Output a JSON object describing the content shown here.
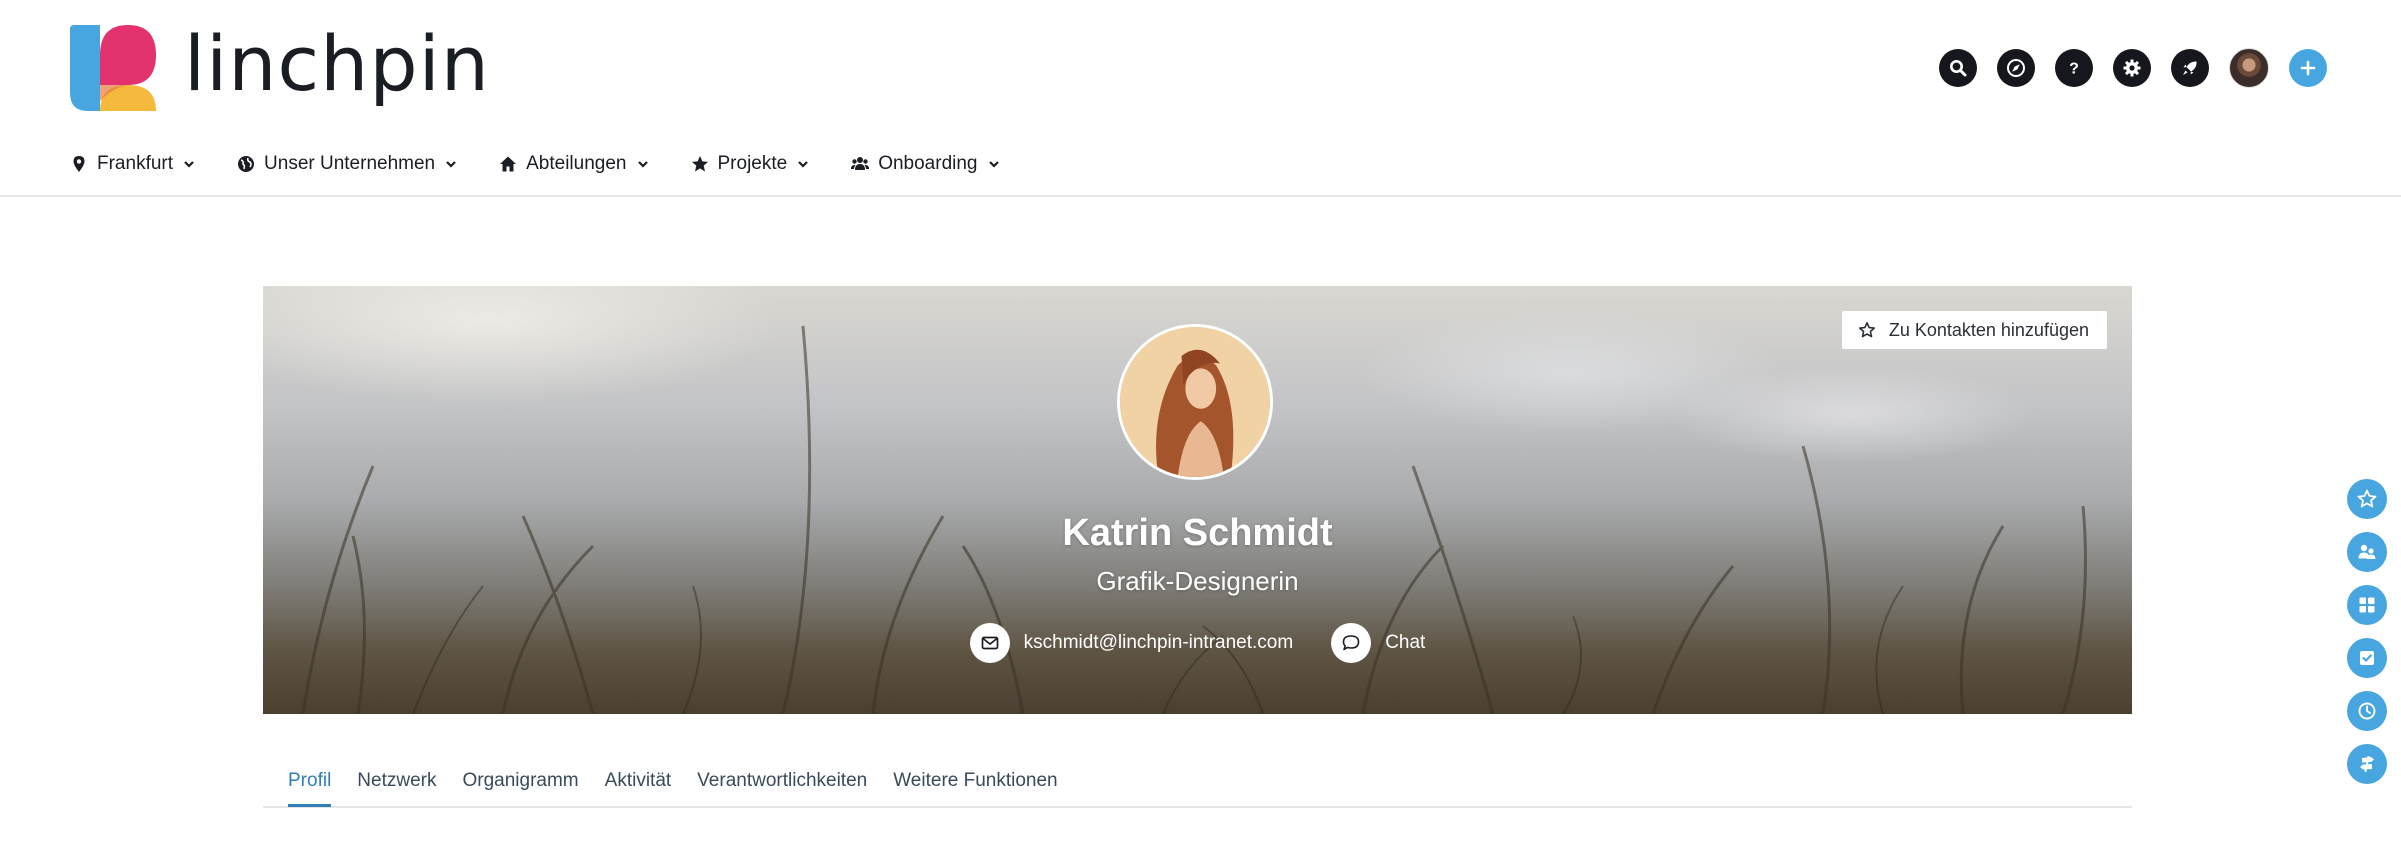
{
  "app": {
    "logo_text": "linchpin",
    "brand_colors": {
      "blue": "#47a6df",
      "pink": "#e2336e",
      "yellow": "#f5b93d",
      "dark": "#15171c"
    }
  },
  "header_icons": [
    {
      "name": "search-icon"
    },
    {
      "name": "compass-icon"
    },
    {
      "name": "help-icon"
    },
    {
      "name": "gear-icon"
    },
    {
      "name": "rocket-icon"
    },
    {
      "name": "user-avatar"
    },
    {
      "name": "plus-icon"
    }
  ],
  "nav": {
    "items": [
      {
        "label": "Frankfurt",
        "icon": "map-pin-icon"
      },
      {
        "label": "Unser Unternehmen",
        "icon": "globe-icon"
      },
      {
        "label": "Abteilungen",
        "icon": "home-icon"
      },
      {
        "label": "Projekte",
        "icon": "star-icon"
      },
      {
        "label": "Onboarding",
        "icon": "users-icon"
      }
    ]
  },
  "profile": {
    "add_contact_label": "Zu Kontakten hinzufügen",
    "name": "Katrin Schmidt",
    "role": "Grafik-Designerin",
    "email": "kschmidt@linchpin-intranet.com",
    "chat_label": "Chat"
  },
  "tabs": [
    {
      "label": "Profil",
      "active": true
    },
    {
      "label": "Netzwerk",
      "active": false
    },
    {
      "label": "Organigramm",
      "active": false
    },
    {
      "label": "Aktivität",
      "active": false
    },
    {
      "label": "Verantwortlichkeiten",
      "active": false
    },
    {
      "label": "Weitere Funktionen",
      "active": false
    }
  ],
  "floating_bar": [
    {
      "name": "favorites-icon"
    },
    {
      "name": "people-icon"
    },
    {
      "name": "apps-grid-icon"
    },
    {
      "name": "tasks-checkbox-icon"
    },
    {
      "name": "clock-icon"
    },
    {
      "name": "signpost-icon"
    }
  ]
}
